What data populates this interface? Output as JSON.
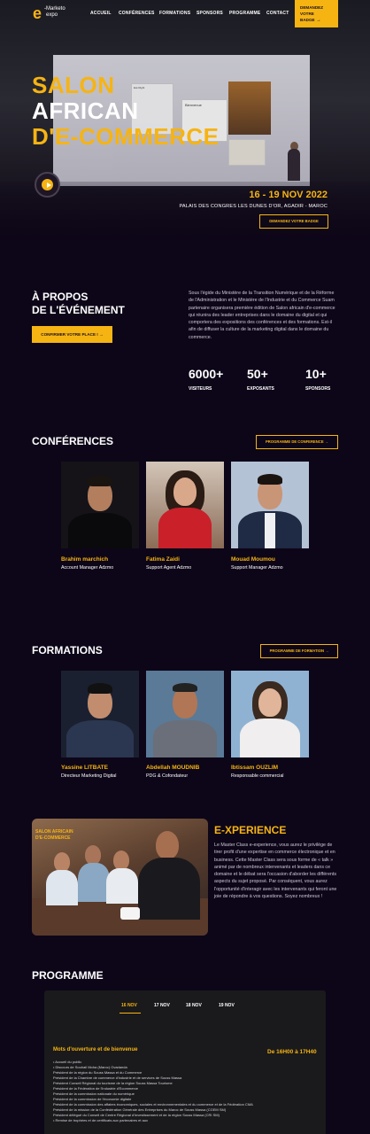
{
  "logo": {
    "mark": "e",
    "line1": "-Marketo",
    "line2": "expo"
  },
  "nav": [
    "ACCUEIL",
    "CONFÉRENCES",
    "FORMATIONS",
    "SPONSORS",
    "PROGRAMME",
    "CONTACT"
  ],
  "header_cta": {
    "line1": "DEMANDEZ",
    "line2": "VOTRE",
    "line3": "BADGE",
    "arrow": "→"
  },
  "hero": {
    "title_line1": "SALON",
    "title_line2": "AFRICAN",
    "title_line3": "D'E-COMMERCE",
    "date": "16 - 19 NOV 2022",
    "venue": "PALAIS DES CONGRES LES DUNES D'OR, AGADIR - MAROC",
    "badge_button": "DEMANDEZ VOTRE BADGE",
    "screen_heading": "Bienvenue",
    "screen_logo": "Eat Right"
  },
  "about": {
    "title_line1": "À PROPOS",
    "title_line2": "DE L'ÉVÉNEMENT",
    "button": "CONFIRMER VOTRE PLACE !",
    "text": "Sous l'égide du Ministère de la Transition Numérique et de la Réforme de l'Administration et le Ministère de l'Industrie et du Commerce Suam partenaire organisera première édition de Salon africain d'e-commerce qui réunira des leader entreprises dans le domaine du digital et qui comportera des expositions des conférences et des formations. Est-il afin de diffuser la culture de la marketing digital dans le domaine du commerce.",
    "stats": [
      {
        "value": "6000+",
        "label": "VISITEURS"
      },
      {
        "value": "50+",
        "label": "EXPOSANTS"
      },
      {
        "value": "10+",
        "label": "SPONSORS"
      }
    ]
  },
  "conferences": {
    "title": "CONFÉRENCES",
    "button": "PROGRAMME DE CONFERENCE",
    "speakers": [
      {
        "name": "Brahim marchich",
        "role": "Account Manager Adzmo"
      },
      {
        "name": "Fatima Zaidi",
        "role": "Support Agent Adzmo"
      },
      {
        "name": "Mouad Moumou",
        "role": "Support Manager Adzmo"
      }
    ]
  },
  "formations": {
    "title": "FORMATIONS",
    "button": "PROGRAMME DE FORMATION",
    "trainers": [
      {
        "name": "Yassine LITBATE",
        "role": "Directeur Marketing Digital"
      },
      {
        "name": "Abdellah MOUDNIB",
        "role": "PDG & Cofondateur"
      },
      {
        "name": "Ibtissam OUZLIM",
        "role": "Responsable commercial"
      }
    ]
  },
  "experience": {
    "title": "E-XPERIENCE",
    "img_banner_line1": "SALON AFRICAIN",
    "img_banner_line2": "D'E-COMMERCE",
    "text": "Le Master Class e-experience, vous aurez le privilège de tirer profit d'une expertise en commerce électronique et en business. Cette Master Class sera sous forme de « talk » animé par de nombreux intervenants et leaders dans ce domaine et le débat sera l'occasion d'aborder les différents aspects du sujet proposé. Par conséquent, vous aurez l'opportunité d'interagir avec les intervenants qui feront une joie de répondre à vos questions. Soyez nombreux !"
  },
  "programme": {
    "title": "PROGRAMME",
    "tabs": [
      "16 NOV",
      "17 NOV",
      "18 NOV",
      "19 NOV"
    ],
    "active_tab": 0,
    "session_title": "Mots d'ouverture et de bienvenue",
    "session_time": "De 16H00 à 17H40",
    "items": [
      "• Accueil du public",
      "• Discours de Souhail Moha (Maroc) Ovadanda",
      "  Président de la région du Souss Massa et du Commerce",
      "  Président de la Chambre de commerce d'industrie et de services de Souss Massa",
      "  Président Conseil Régional du tourisme de la région Souss Massa Tourisme",
      "  Président de la Fédération de l'Industrie d'Ecommerce",
      "  Président de la commission nationale du numérique",
      "  Président de la commission de l'économie digitale",
      "  Président de la commission des affaires économiques, sociales et environnementales et du commerce et de la Fédération CMA",
      "  Président de la mission de la Confédération Générale des Entreprises du Maroc de Souss Massa (CGEM SM)",
      "  Président délégué du Conseil de Centre Régional d'Investissement et de la région Souss Massa (CRI SM)",
      "• Remise de trophées et de certificats aux partenaires et aux"
    ]
  },
  "colors": {
    "accent": "#f6b413",
    "background": "#0d0618",
    "panel": "#1a1a1c"
  }
}
